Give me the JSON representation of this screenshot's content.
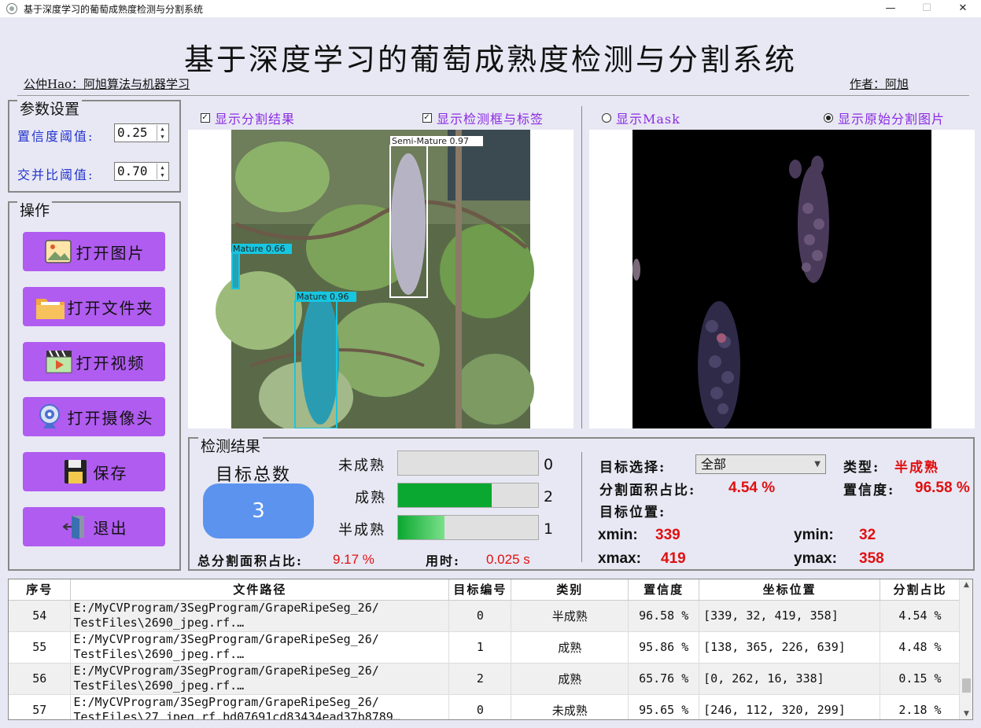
{
  "window": {
    "title": "基于深度学习的葡萄成熟度检测与分割系统",
    "minimize": "—",
    "maximize": "☐",
    "close": "✕"
  },
  "header": {
    "title": "基于深度学习的葡萄成熟度检测与分割系统",
    "left_text": "公仲Hao：阿旭算法与机器学习",
    "right_text": "作者：阿旭"
  },
  "params": {
    "title": "参数设置",
    "conf_label": "置信度阈值:",
    "conf_value": "0.25",
    "iou_label": "交并比阈值:",
    "iou_value": "0.70"
  },
  "ops": {
    "title": "操作",
    "open_image": "打开图片",
    "open_folder": "打开文件夹",
    "open_video": "打开视频",
    "open_camera": "打开摄像头",
    "save": "保存",
    "exit": "退出"
  },
  "display": {
    "show_seg": "显示分割结果",
    "show_box": "显示检测框与标签",
    "show_mask": "显示Mask",
    "show_orig_seg": "显示原始分割图片",
    "box_labels": [
      "Semi-Mature 0.97",
      "Mature 0.66",
      "Mature 0.96"
    ]
  },
  "results": {
    "title": "检测结果",
    "total_title": "目标总数",
    "total_count": "3",
    "classes": [
      {
        "label": "未成熟",
        "count": "0",
        "fraction": 0.0
      },
      {
        "label": "成熟",
        "count": "2",
        "fraction": 0.67
      },
      {
        "label": "半成熟",
        "count": "1",
        "fraction": 0.33
      }
    ],
    "total_area_label": "总分割面积占比:",
    "total_area_value": "9.17 %",
    "time_label": "用时:",
    "time_value": "0.025 s",
    "target_select_label": "目标选择:",
    "target_select_value": "全部",
    "type_label": "类型:",
    "type_value": "半成熟",
    "area_label": "分割面积占比:",
    "area_value": "4.54 %",
    "conf_label": "置信度:",
    "conf_value": "96.58 %",
    "pos_label": "目标位置:",
    "xmin_label": "xmin:",
    "xmin": "339",
    "ymin_label": "ymin:",
    "ymin": "32",
    "xmax_label": "xmax:",
    "xmax": "419",
    "ymax_label": "ymax:",
    "ymax": "358"
  },
  "table": {
    "headers": [
      "序号",
      "文件路径",
      "目标编号",
      "类别",
      "置信度",
      "坐标位置",
      "分割占比"
    ],
    "rows": [
      {
        "idx": "54",
        "path1": "E:/MyCVProgram/3SegProgram/GrapeRipeSeg_26/",
        "path2": "TestFiles\\2690_jpeg.rf.…",
        "obj": "0",
        "cat": "半成熟",
        "conf": "96.58 %",
        "coords": "[339, 32, 419, 358]",
        "ratio": "4.54 %"
      },
      {
        "idx": "55",
        "path1": "E:/MyCVProgram/3SegProgram/GrapeRipeSeg_26/",
        "path2": "TestFiles\\2690_jpeg.rf.…",
        "obj": "1",
        "cat": "成熟",
        "conf": "95.86 %",
        "coords": "[138, 365, 226, 639]",
        "ratio": "4.48 %"
      },
      {
        "idx": "56",
        "path1": "E:/MyCVProgram/3SegProgram/GrapeRipeSeg_26/",
        "path2": "TestFiles\\2690_jpeg.rf.…",
        "obj": "2",
        "cat": "成熟",
        "conf": "65.76 %",
        "coords": "[0, 262, 16, 338]",
        "ratio": "0.15 %"
      },
      {
        "idx": "57",
        "path1": "E:/MyCVProgram/3SegProgram/GrapeRipeSeg_26/",
        "path2": "TestFiles\\27_jpeg.rf.bd07691cd83434ead37b8789…",
        "obj": "0",
        "cat": "未成熟",
        "conf": "95.65 %",
        "coords": "[246, 112, 320, 299]",
        "ratio": "2.18 %"
      }
    ]
  }
}
